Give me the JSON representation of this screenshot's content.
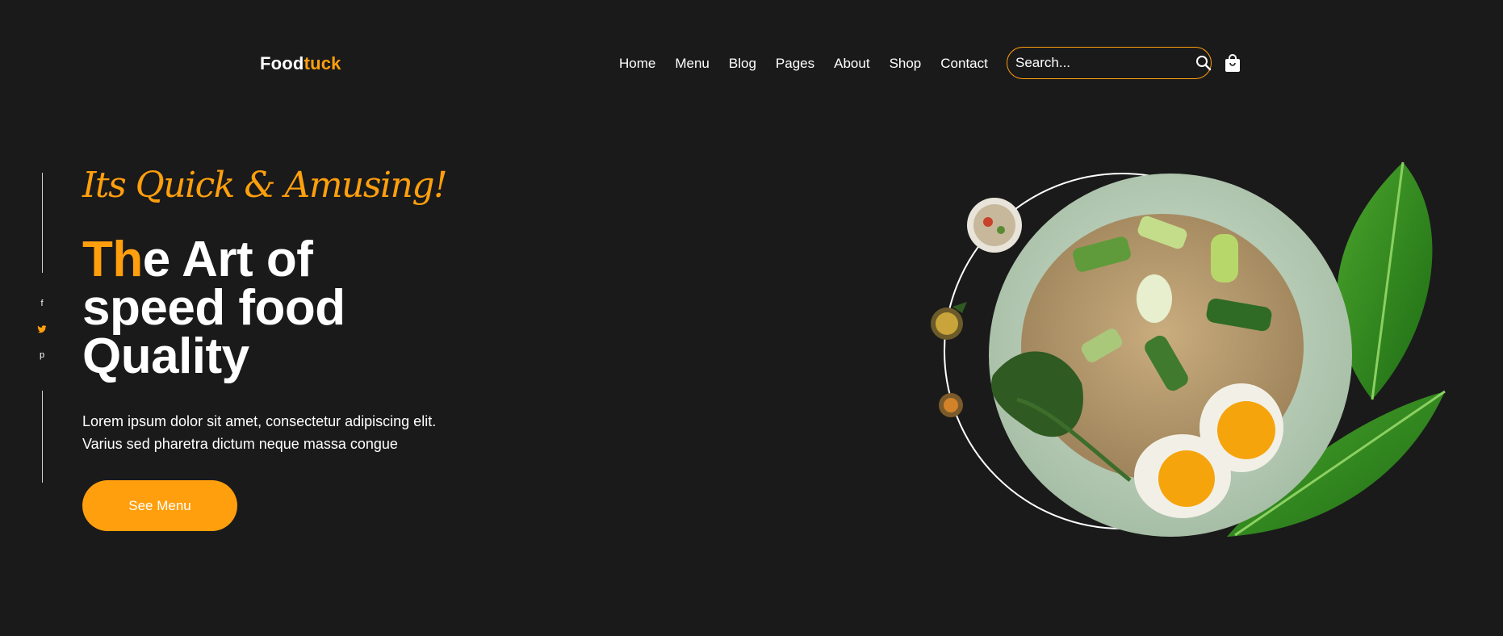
{
  "header": {
    "logo_main": "Food",
    "logo_accent": "tuck",
    "nav": [
      "Home",
      "Menu",
      "Blog",
      "Pages",
      "About",
      "Shop",
      "Contact"
    ],
    "search_placeholder": "Search...",
    "search_icon": "search-icon",
    "cart_icon": "shopping-bag-icon"
  },
  "social": {
    "icons": [
      "facebook-icon",
      "twitter-icon",
      "pinterest-icon"
    ],
    "labels": [
      "f",
      "",
      "p"
    ]
  },
  "hero": {
    "tagline": "Its Quick & Amusing!",
    "title_accent": "Th",
    "title_rest_1": "e Art of",
    "title_line_2": "speed food",
    "title_line_3": "Quality",
    "desc_line_1": "Lorem ipsum dolor sit amet, consectetur adipiscing elit.",
    "desc_line_2": "Varius sed pharetra dictum neque massa congue",
    "cta_label": "See Menu"
  },
  "colors": {
    "accent": "#ff9f0d",
    "background": "#1a1a1a",
    "text": "#ffffff"
  }
}
